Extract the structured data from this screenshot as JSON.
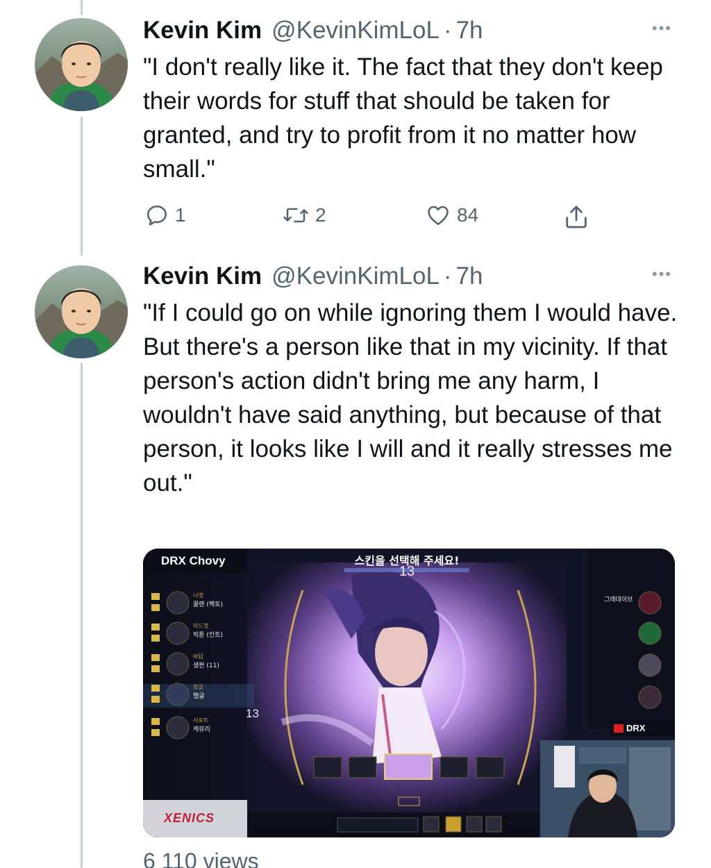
{
  "tweets": [
    {
      "name": "Kevin Kim",
      "handle": "@KevinKimLoL",
      "separator": "·",
      "time": "7h",
      "more": "•••",
      "text": "\"I don't really like it. The fact that they don't keep their words for stuff that should be taken for granted, and try to profit from it no matter how small.\"",
      "replies": "1",
      "retweets": "2",
      "likes": "84"
    },
    {
      "name": "Kevin Kim",
      "handle": "@KevinKimLoL",
      "separator": "·",
      "time": "7h",
      "more": "•••",
      "text": "\"If I could go on while ignoring them I would have. But there's a person like that in my vicinity. If that person's action didn't bring me any harm, I wouldn't have said anything, but because of that person, it looks like I will and it really stresses me out.\""
    }
  ],
  "media": {
    "channel_tag": "DRX Chovy",
    "banner": "스킨을 선택해 주세요!",
    "timer": "13",
    "side_timer": "13",
    "stream_tag": "DRX",
    "sponsor": "XENICS",
    "left_players": [
      {
        "role": "너겟",
        "name": "꿀렌 (팩토)"
      },
      {
        "role": "미드겟",
        "name": "빅툰 (인트)"
      },
      {
        "role": "바텀",
        "name": "생판 (11)"
      },
      {
        "role": "정글",
        "name": "헬글"
      },
      {
        "role": "서포트",
        "name": "케뮤리"
      }
    ],
    "right_players": [
      "그레데이브",
      "",
      "",
      "",
      ""
    ]
  },
  "views_label": "6 110 views",
  "colors": {
    "text": "#0f1419",
    "secondary": "#536471",
    "thread": "#c4cfd6",
    "accent_purple": "#b06cff"
  }
}
